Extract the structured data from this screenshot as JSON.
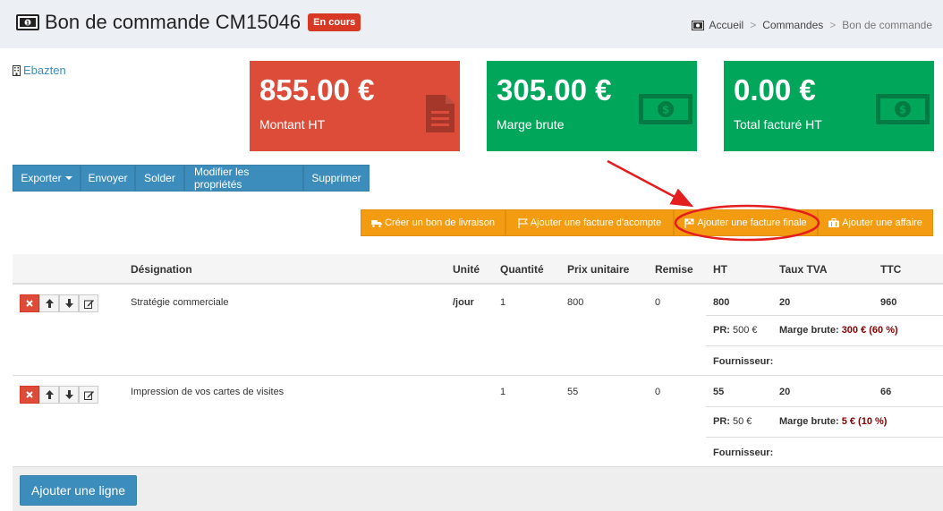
{
  "header": {
    "title": "Bon de commande CM15046",
    "status_badge": "En cours",
    "breadcrumb": [
      "Accueil",
      "Commandes",
      "Bon de commande"
    ],
    "breadcrumb_sep": ">"
  },
  "client": {
    "name": "Ebazten"
  },
  "stats": [
    {
      "amount": "855.00 €",
      "label": "Montant HT",
      "color": "#dd4b39",
      "icon": "file-icon"
    },
    {
      "amount": "305.00 €",
      "label": "Marge brute",
      "color": "#00a65a",
      "icon": "money-icon"
    },
    {
      "amount": "0.00 €",
      "label": "Total facturé HT",
      "color": "#00a65a",
      "icon": "money-icon"
    }
  ],
  "toolbar": {
    "exporter": "Exporter",
    "envoyer": "Envoyer",
    "solder": "Solder",
    "modifier": "Modifier les propriétés",
    "supprimer": "Supprimer"
  },
  "actions": {
    "bon_livraison": "Créer un bon de livraison",
    "facture_acompte": "Ajouter une facture d'acompte",
    "facture_finale": "Ajouter une facture finale",
    "affaire": "Ajouter une affaire"
  },
  "table": {
    "headers": {
      "designation": "Désignation",
      "unite": "Unité",
      "quantite": "Quantité",
      "prix_unitaire": "Prix unitaire",
      "remise": "Remise",
      "ht": "HT",
      "taux_tva": "Taux TVA",
      "ttc": "TTC"
    },
    "labels": {
      "pr": "PR:",
      "marge": "Marge brute:",
      "fournisseur": "Fournisseur:"
    },
    "rows": [
      {
        "designation": "Stratégie commerciale",
        "unite": "/jour",
        "quantite": "1",
        "prix_unitaire": "800",
        "remise": "0",
        "ht": "800",
        "tva": "20",
        "ttc": "960",
        "pr": "500 €",
        "marge": "300 € (60 %)"
      },
      {
        "designation": "Impression de vos cartes de visites",
        "unite": "",
        "quantite": "1",
        "prix_unitaire": "55",
        "remise": "0",
        "ht": "55",
        "tva": "20",
        "ttc": "66",
        "pr": "50 €",
        "marge": "5 € (10 %)"
      }
    ]
  },
  "footer": {
    "add_line": "Ajouter une ligne"
  }
}
